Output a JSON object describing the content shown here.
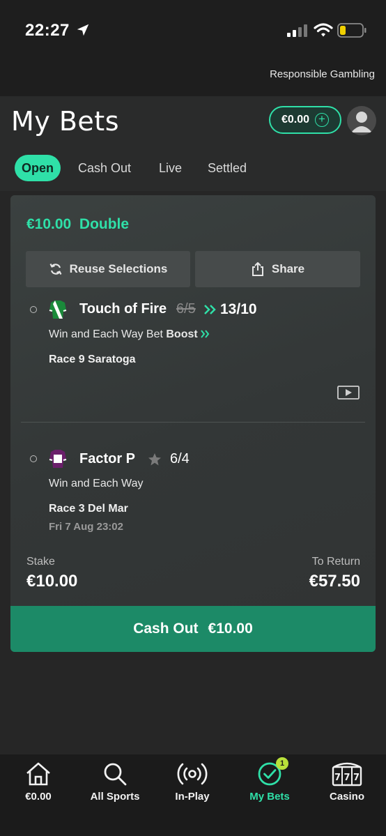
{
  "status_bar": {
    "time": "22:27"
  },
  "responsible_gambling": "Responsible Gambling",
  "header": {
    "title": "My Bets",
    "balance": "€0.00"
  },
  "tabs": [
    {
      "label": "Open",
      "active": true
    },
    {
      "label": "Cash Out",
      "active": false
    },
    {
      "label": "Live",
      "active": false
    },
    {
      "label": "Settled",
      "active": false
    }
  ],
  "bet": {
    "stake_display": "€10.00",
    "bet_type": "Double",
    "reuse_label": "Reuse Selections",
    "share_label": "Share",
    "selections": [
      {
        "horse": "Touch of Fire",
        "old_odds": "6/5",
        "odds": "13/10",
        "market": "Win and Each Way Bet",
        "boost_label": "Boost",
        "race": "Race 9 Saratoga",
        "silk_colors": [
          "#1a8a3a",
          "#ffffff"
        ]
      },
      {
        "horse": "Factor P",
        "odds": "6/4",
        "market": "Win and Each Way",
        "race": "Race 3 Del Mar",
        "date": "Fri 7 Aug 23:02",
        "silk_colors": [
          "#6b1f6b",
          "#ffffff"
        ]
      }
    ],
    "stake_label": "Stake",
    "stake_value": "€10.00",
    "return_label": "To Return",
    "return_value": "€57.50",
    "cashout_label": "Cash Out",
    "cashout_value": "€10.00"
  },
  "nav": [
    {
      "label": "€0.00",
      "icon": "home-icon"
    },
    {
      "label": "All Sports",
      "icon": "search-icon"
    },
    {
      "label": "In-Play",
      "icon": "in-play-icon"
    },
    {
      "label": "My Bets",
      "icon": "check-circle-icon",
      "badge": "1",
      "active": true
    },
    {
      "label": "Casino",
      "icon": "slot-machine-icon"
    }
  ],
  "colors": {
    "accent": "#2fe0a8",
    "cashout_bg": "#1c8a67",
    "background": "#262626"
  }
}
